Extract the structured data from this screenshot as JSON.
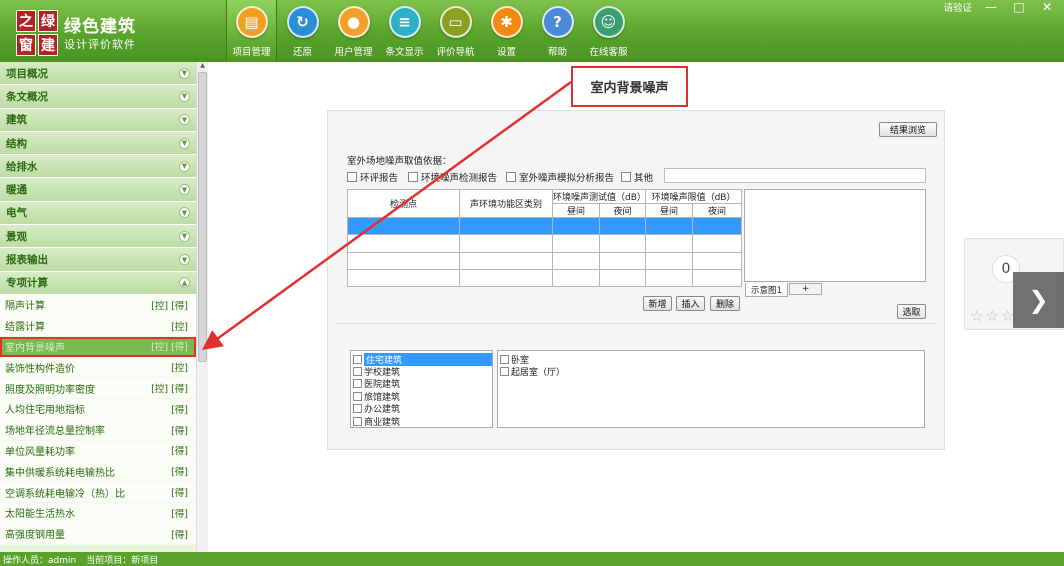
{
  "app": {
    "logo_chars": [
      "之",
      "绿",
      "窗",
      "建"
    ],
    "name": "绿色建筑",
    "subtitle": "设计评价软件"
  },
  "toolbar": [
    {
      "label": "项目管理",
      "icon": "notebook-icon",
      "color": "#f0a020",
      "glyph": "▤",
      "active": true
    },
    {
      "label": "还原",
      "icon": "restore-icon",
      "color": "#2a8fd6",
      "glyph": "↻"
    },
    {
      "label": "用户管理",
      "icon": "users-icon",
      "color": "#f2a02a",
      "glyph": "●"
    },
    {
      "label": "条文显示",
      "icon": "doc-icon",
      "color": "#2fb0c8",
      "glyph": "≡"
    },
    {
      "label": "评价导航",
      "icon": "nav-icon",
      "color": "#8aa020",
      "glyph": "▭"
    },
    {
      "label": "设置",
      "icon": "gear-icon",
      "color": "#f08a10",
      "glyph": "✱"
    },
    {
      "label": "帮助",
      "icon": "help-icon",
      "color": "#4a8ad6",
      "glyph": "?"
    },
    {
      "label": "在线客服",
      "icon": "support-icon",
      "color": "#3aa070",
      "glyph": "☺"
    }
  ],
  "window": {
    "verify_label": "请验证",
    "min": "—",
    "max": "□",
    "close": "✕"
  },
  "sidebar": {
    "categories_top": [
      "项目概况",
      "条文概况",
      "建筑",
      "结构",
      "给排水",
      "暖通",
      "电气",
      "景观",
      "报表输出"
    ],
    "special": {
      "label": "专项计算",
      "items": [
        {
          "label": "隔声计算",
          "tag": "[控] [得]"
        },
        {
          "label": "结露计算",
          "tag": "[控]"
        },
        {
          "label": "室内背景噪声",
          "tag": "[控] [得]",
          "selected": true
        },
        {
          "label": "装饰性构件造价",
          "tag": "[控]"
        },
        {
          "label": "照度及照明功率密度",
          "tag": "[控] [得]"
        },
        {
          "label": "人均住宅用地指标",
          "tag": "[得]"
        },
        {
          "label": "场地年径流总量控制率",
          "tag": "[得]"
        },
        {
          "label": "单位风量耗功率",
          "tag": "[得]"
        },
        {
          "label": "集中供暖系统耗电输热比",
          "tag": "[得]"
        },
        {
          "label": "空调系统耗电输冷（热）比",
          "tag": "[得]"
        },
        {
          "label": "太阳能生活热水",
          "tag": "[得]"
        },
        {
          "label": "高强度钢用量",
          "tag": "[得]"
        }
      ]
    }
  },
  "status": {
    "operator": "操作人员：admin",
    "project": "当前项目：新项目"
  },
  "main": {
    "title": "室内背景噪声",
    "results_button": "结果浏览",
    "basis_label": "室外场地噪声取值依据：",
    "basis_options": [
      "环评报告",
      "环境噪声检测报告",
      "室外噪声模拟分析报告",
      "其他"
    ],
    "table": {
      "col_point": "检测点",
      "col_zone": "声环境功能区类别",
      "grp_measured": "环境噪声测试值（dB）",
      "grp_limit": "环境噪声限值（dB）",
      "day": "昼间",
      "night": "夜间",
      "rows": 4
    },
    "buttons": {
      "add": "新增",
      "insert": "插入",
      "delete": "删除",
      "choose": "选取"
    },
    "preview_tab": "示意图1",
    "preview_add": "+",
    "building_types": [
      {
        "label": "住宅建筑",
        "selected": true
      },
      {
        "label": "学校建筑"
      },
      {
        "label": "医院建筑"
      },
      {
        "label": "旅馆建筑"
      },
      {
        "label": "办公建筑"
      },
      {
        "label": "商业建筑"
      }
    ],
    "room_types": [
      "卧室",
      "起居室（厅）"
    ]
  },
  "widget": {
    "score": "0",
    "stars": "☆☆☆",
    "next": "❯"
  },
  "colors": {
    "brand_green": "#56a22a",
    "sidebar_text": "#2b6b10",
    "highlight_red": "#e03030",
    "selection_blue": "#3399ff"
  }
}
